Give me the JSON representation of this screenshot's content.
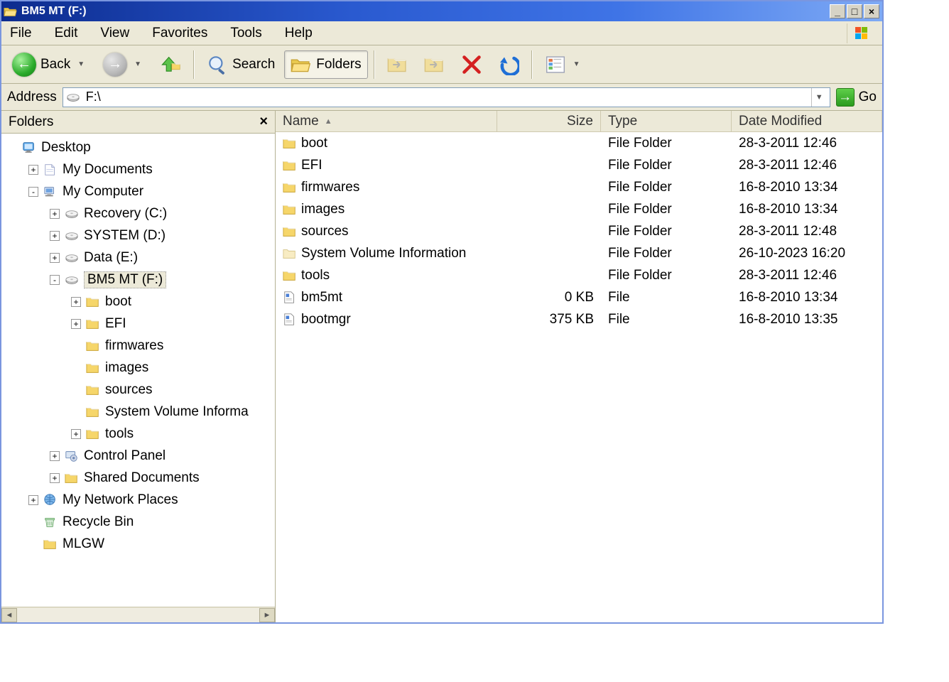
{
  "window": {
    "title": "BM5 MT (F:)"
  },
  "menu": {
    "file": "File",
    "edit": "Edit",
    "view": "View",
    "favorites": "Favorites",
    "tools": "Tools",
    "help": "Help"
  },
  "toolbar": {
    "back": "Back",
    "search": "Search",
    "folders": "Folders"
  },
  "address": {
    "label": "Address",
    "value": "F:\\",
    "go": "Go"
  },
  "side": {
    "title": "Folders",
    "items": [
      {
        "indent": 0,
        "expand": "",
        "icon": "desktop",
        "label": "Desktop",
        "sel": false
      },
      {
        "indent": 1,
        "expand": "+",
        "icon": "mydocs",
        "label": "My Documents",
        "sel": false
      },
      {
        "indent": 1,
        "expand": "-",
        "icon": "mycomp",
        "label": "My Computer",
        "sel": false
      },
      {
        "indent": 2,
        "expand": "+",
        "icon": "drive",
        "label": "Recovery  (C:)",
        "sel": false
      },
      {
        "indent": 2,
        "expand": "+",
        "icon": "drive",
        "label": "SYSTEM (D:)",
        "sel": false
      },
      {
        "indent": 2,
        "expand": "+",
        "icon": "drive",
        "label": "Data  (E:)",
        "sel": false
      },
      {
        "indent": 2,
        "expand": "-",
        "icon": "drive",
        "label": "BM5 MT (F:)",
        "sel": true
      },
      {
        "indent": 3,
        "expand": "+",
        "icon": "folder",
        "label": "boot",
        "sel": false
      },
      {
        "indent": 3,
        "expand": "+",
        "icon": "folder",
        "label": "EFI",
        "sel": false
      },
      {
        "indent": 3,
        "expand": "",
        "icon": "folder",
        "label": "firmwares",
        "sel": false
      },
      {
        "indent": 3,
        "expand": "",
        "icon": "folder",
        "label": "images",
        "sel": false
      },
      {
        "indent": 3,
        "expand": "",
        "icon": "folder",
        "label": "sources",
        "sel": false
      },
      {
        "indent": 3,
        "expand": "",
        "icon": "folder",
        "label": "System Volume Informa",
        "sel": false
      },
      {
        "indent": 3,
        "expand": "+",
        "icon": "folder",
        "label": "tools",
        "sel": false
      },
      {
        "indent": 2,
        "expand": "+",
        "icon": "cpanel",
        "label": "Control Panel",
        "sel": false
      },
      {
        "indent": 2,
        "expand": "+",
        "icon": "folder",
        "label": "Shared Documents",
        "sel": false
      },
      {
        "indent": 1,
        "expand": "+",
        "icon": "netplaces",
        "label": "My Network Places",
        "sel": false
      },
      {
        "indent": 1,
        "expand": "",
        "icon": "recycle",
        "label": "Recycle Bin",
        "sel": false
      },
      {
        "indent": 1,
        "expand": "",
        "icon": "folder",
        "label": "MLGW",
        "sel": false
      }
    ]
  },
  "columns": {
    "name": "Name",
    "size": "Size",
    "type": "Type",
    "date": "Date Modified"
  },
  "rows": [
    {
      "icon": "folder",
      "name": "boot",
      "size": "",
      "type": "File Folder",
      "date": "28-3-2011 12:46"
    },
    {
      "icon": "folder",
      "name": "EFI",
      "size": "",
      "type": "File Folder",
      "date": "28-3-2011 12:46"
    },
    {
      "icon": "folder",
      "name": "firmwares",
      "size": "",
      "type": "File Folder",
      "date": "16-8-2010 13:34"
    },
    {
      "icon": "folder",
      "name": "images",
      "size": "",
      "type": "File Folder",
      "date": "16-8-2010 13:34"
    },
    {
      "icon": "folder",
      "name": "sources",
      "size": "",
      "type": "File Folder",
      "date": "28-3-2011 12:48"
    },
    {
      "icon": "folderlt",
      "name": "System Volume Information",
      "size": "",
      "type": "File Folder",
      "date": "26-10-2023 16:20"
    },
    {
      "icon": "folder",
      "name": "tools",
      "size": "",
      "type": "File Folder",
      "date": "28-3-2011 12:46"
    },
    {
      "icon": "file",
      "name": "bm5mt",
      "size": "0 KB",
      "type": "File",
      "date": "16-8-2010 13:34"
    },
    {
      "icon": "file",
      "name": "bootmgr",
      "size": "375 KB",
      "type": "File",
      "date": "16-8-2010 13:35"
    }
  ]
}
